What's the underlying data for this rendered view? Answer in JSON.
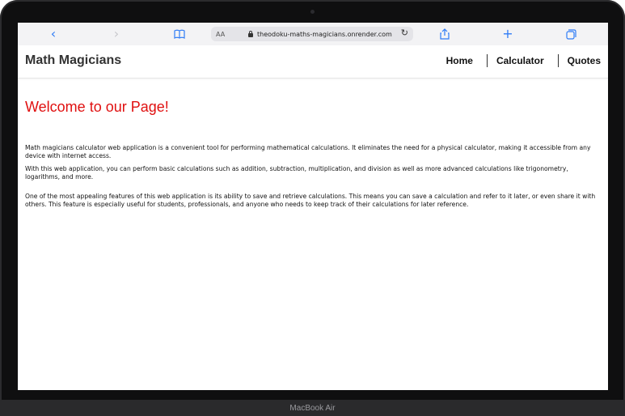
{
  "device": {
    "label": "MacBook Air"
  },
  "browser": {
    "text_size_label": "AA",
    "url": "theodoku-maths-magicians.onrender.com",
    "icons": {
      "back": "chevron-left-icon",
      "forward": "chevron-right-icon",
      "reader": "book-icon",
      "reload": "reload-icon",
      "share": "share-icon",
      "new_tab": "plus-icon",
      "tabs": "tabs-icon",
      "lock": "lock-icon"
    },
    "accent_color": "#2f7cf6"
  },
  "nav": {
    "brand": "Math Magicians",
    "links": [
      {
        "label": "Home"
      },
      {
        "label": "Calculator"
      },
      {
        "label": "Quotes"
      }
    ]
  },
  "main": {
    "heading": "Welcome to our Page!",
    "heading_color": "#e01010",
    "paragraphs": [
      "Math magicians calculator web application is a convenient tool for performing mathematical calculations. It eliminates the need for a physical calculator, making it accessible from any device with internet access.",
      "With this web application, you can perform basic calculations such as addition, subtraction, multiplication, and division as well as more advanced calculations like trigonometry, logarithms, and more.",
      "One of the most appealing features of this web application is its ability to save and retrieve calculations. This means you can save a calculation and refer to it later, or even share it with others. This feature is especially useful for students, professionals, and anyone who needs to keep track of their calculations for later reference."
    ]
  }
}
